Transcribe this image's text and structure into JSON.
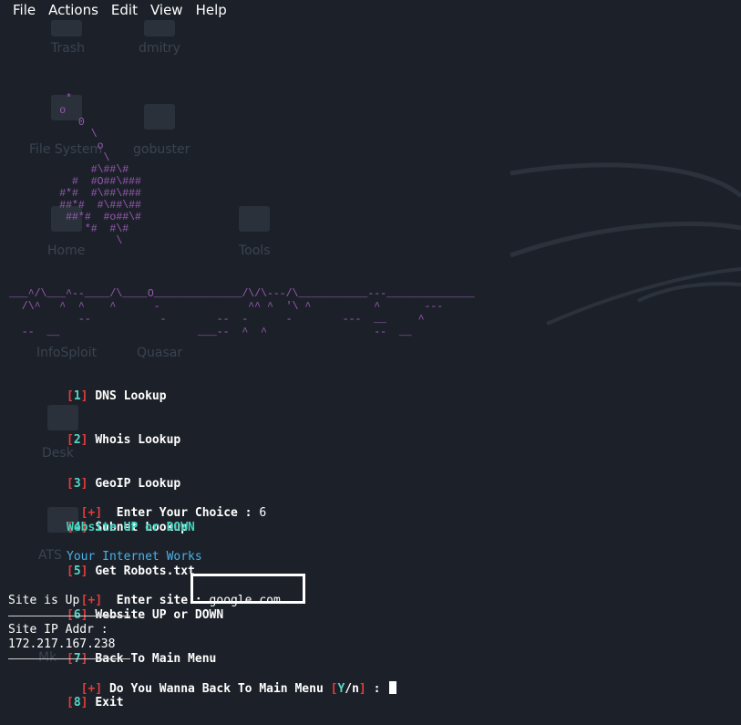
{
  "menu": [
    "File",
    "Actions",
    "Edit",
    "View",
    "Help"
  ],
  "desktop_icons": [
    "Trash",
    "dmitry",
    "File System",
    "gobuster",
    "Home",
    "Tools",
    "InfoSploit",
    "Quasar",
    "Desk",
    "ATS",
    "Mk"
  ],
  "ascii_art": "         *       \n        o        \n           0     \n             \\   \n              o  \n               \\ \n             #\\##\\#\n          #  #O##\\###\n        #*#  #\\##\\###\n        ##*#  #\\##\\##\n         ##*#  #o##\\#\n            *#  #\\#\n                 \\",
  "ascii_banner": "___^/\\___^--____/\\____O______________/\\/\\---/\\___________---______________\n  /\\^   ^  ^    ^      -              ^^ ^  '\\ ^          ^       ---\n           --           -        --  -      -        ---  __     ^\n  --  __                      ___--  ^  ^                 --  __",
  "menu_options": [
    {
      "num": "1",
      "label": "DNS Lookup"
    },
    {
      "num": "2",
      "label": "Whois Lookup"
    },
    {
      "num": "3",
      "label": "GeoIP Lookup"
    },
    {
      "num": "4",
      "label": "Subnet Lookup"
    },
    {
      "num": "5",
      "label": "Get Robots.txt"
    },
    {
      "num": "6",
      "label": "Website UP or DOWN"
    },
    {
      "num": "7",
      "label": "Back To Main Menu"
    },
    {
      "num": "8",
      "label": "Exit"
    }
  ],
  "prompt_plus": "+",
  "choice_label": "Enter Your Choice :",
  "choice_value": "6",
  "section_title": "Website UP or DOWN",
  "internet_status": "Your Internet Works",
  "site_label": "Enter site :",
  "site_value": "google.com",
  "site_status": "Site is Up",
  "ip_label": "Site IP Addr :",
  "ip_value": "172.217.167.238",
  "back_prompt": "Do You Wanna Back To Main Menu",
  "yn_y": "Y",
  "yn_n": "n",
  "back_colon": ":"
}
